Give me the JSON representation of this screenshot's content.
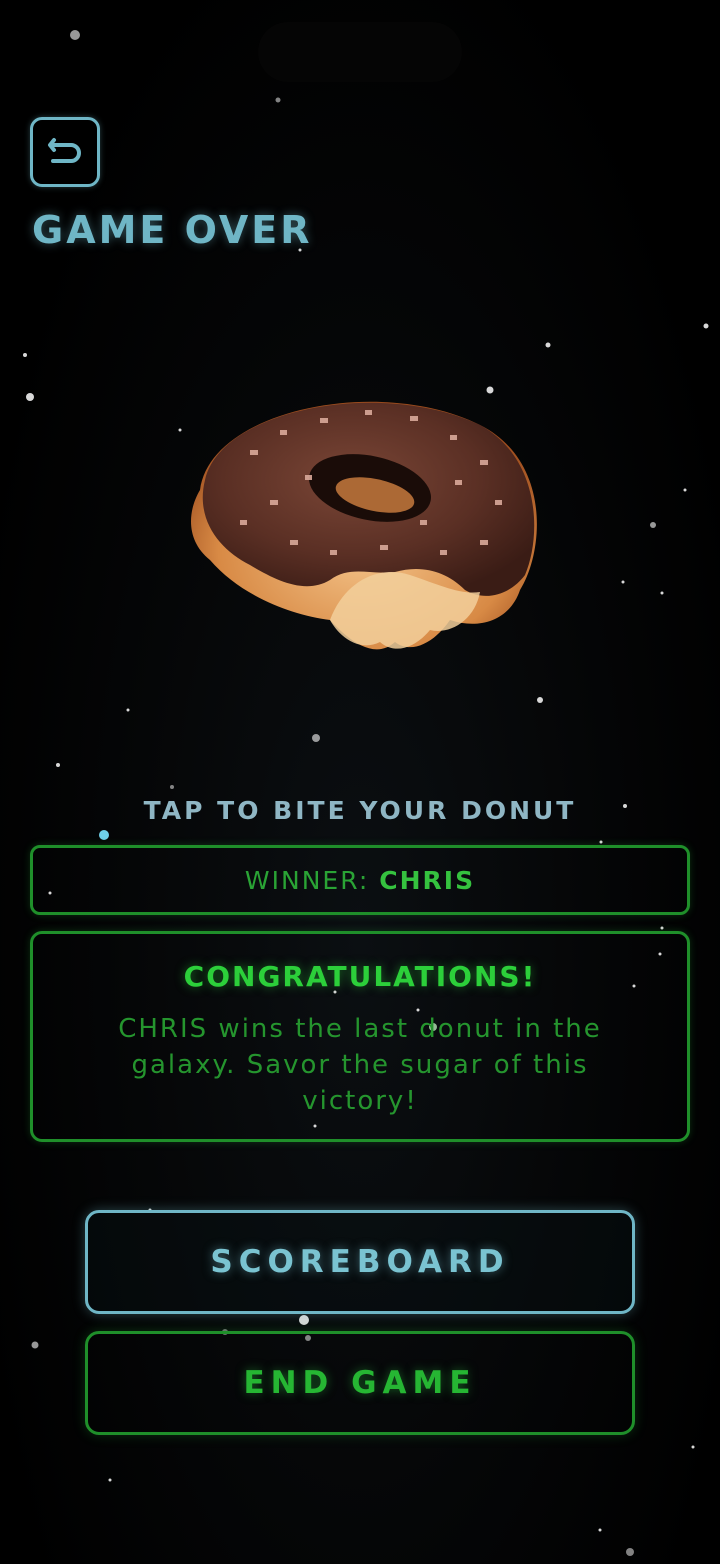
{
  "header": {
    "title": "GAME OVER",
    "back_icon": "undo-arrow-icon",
    "accent_color": "#6fb6c6"
  },
  "donut": {
    "image": "chocolate-frosted-donut-bitten"
  },
  "prompt": {
    "text": "TAP TO BITE YOUR DONUT"
  },
  "winner": {
    "label": "WINNER:",
    "name": "CHRIS"
  },
  "congrats": {
    "title": "CONGRATULATIONS!",
    "message": "CHRIS wins the last donut in the galaxy. Savor the sugar of this victory!"
  },
  "actions": {
    "scoreboard_label": "SCOREBOARD",
    "end_game_label": "END GAME",
    "green_color": "#26b633"
  }
}
